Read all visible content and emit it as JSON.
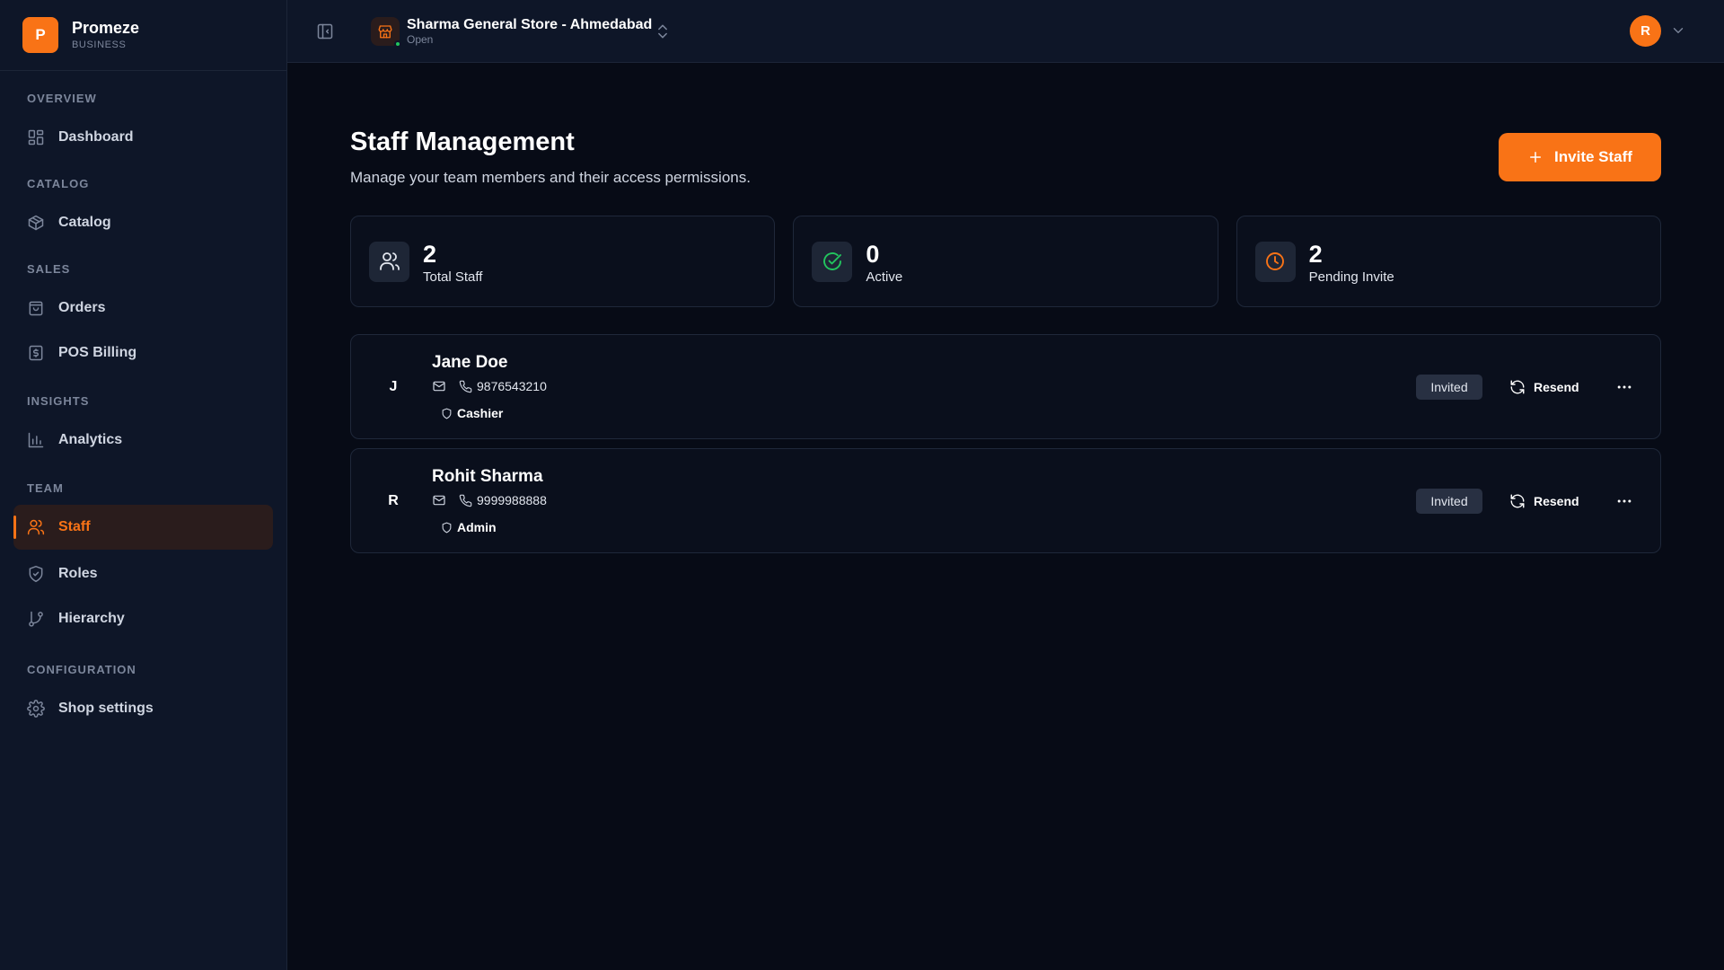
{
  "brand": {
    "logo_letter": "P",
    "name": "Promeze",
    "subtitle": "BUSINESS"
  },
  "sidebar": {
    "sections": [
      {
        "label": "OVERVIEW",
        "items": [
          {
            "label": "Dashboard",
            "icon": "dashboard-icon"
          }
        ]
      },
      {
        "label": "CATALOG",
        "items": [
          {
            "label": "Catalog",
            "icon": "package-icon"
          }
        ]
      },
      {
        "label": "SALES",
        "items": [
          {
            "label": "Orders",
            "icon": "shopping-bag-icon"
          },
          {
            "label": "POS Billing",
            "icon": "receipt-icon"
          }
        ]
      },
      {
        "label": "INSIGHTS",
        "items": [
          {
            "label": "Analytics",
            "icon": "bar-chart-icon"
          }
        ]
      },
      {
        "label": "TEAM",
        "items": [
          {
            "label": "Staff",
            "icon": "users-icon",
            "active": true
          },
          {
            "label": "Roles",
            "icon": "shield-icon"
          },
          {
            "label": "Hierarchy",
            "icon": "git-branch-icon"
          }
        ]
      },
      {
        "label": "CONFIGURATION",
        "items": [
          {
            "label": "Shop settings",
            "icon": "gear-icon"
          }
        ]
      }
    ]
  },
  "topbar": {
    "store_name": "Sharma General Store - Ahmedabad",
    "store_status": "Open",
    "user_initial": "R"
  },
  "page": {
    "title": "Staff Management",
    "subtitle": "Manage your team members and their access permissions.",
    "invite_label": "Invite Staff"
  },
  "stats": [
    {
      "value": "2",
      "label": "Total Staff",
      "icon": "users-icon",
      "color": "#e2e6ee"
    },
    {
      "value": "0",
      "label": "Active",
      "icon": "check-circle-icon",
      "color": "#22c55e"
    },
    {
      "value": "2",
      "label": "Pending Invite",
      "icon": "clock-icon",
      "color": "#f97316"
    }
  ],
  "staff": [
    {
      "initial": "J",
      "name": "Jane Doe",
      "phone": "9876543210",
      "role": "Cashier",
      "status": "Invited",
      "action": "Resend"
    },
    {
      "initial": "R",
      "name": "Rohit Sharma",
      "phone": "9999988888",
      "role": "Admin",
      "status": "Invited",
      "action": "Resend"
    }
  ],
  "colors": {
    "accent": "#f97316",
    "background": "#070b16",
    "sidebar": "#0e1628",
    "success": "#22c55e"
  }
}
